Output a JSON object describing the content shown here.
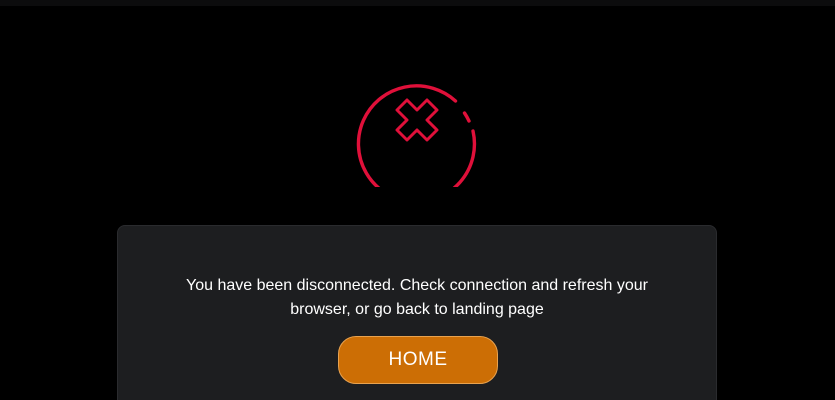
{
  "status": {
    "icon": "disconnected-x-icon",
    "icon_color": "#e0103a"
  },
  "dialog": {
    "message": "You have been disconnected. Check connection and refresh your browser, or go back to landing page",
    "home_button_label": "HOME",
    "button_color": "#cc6e05",
    "card_color": "#1d1e20"
  }
}
